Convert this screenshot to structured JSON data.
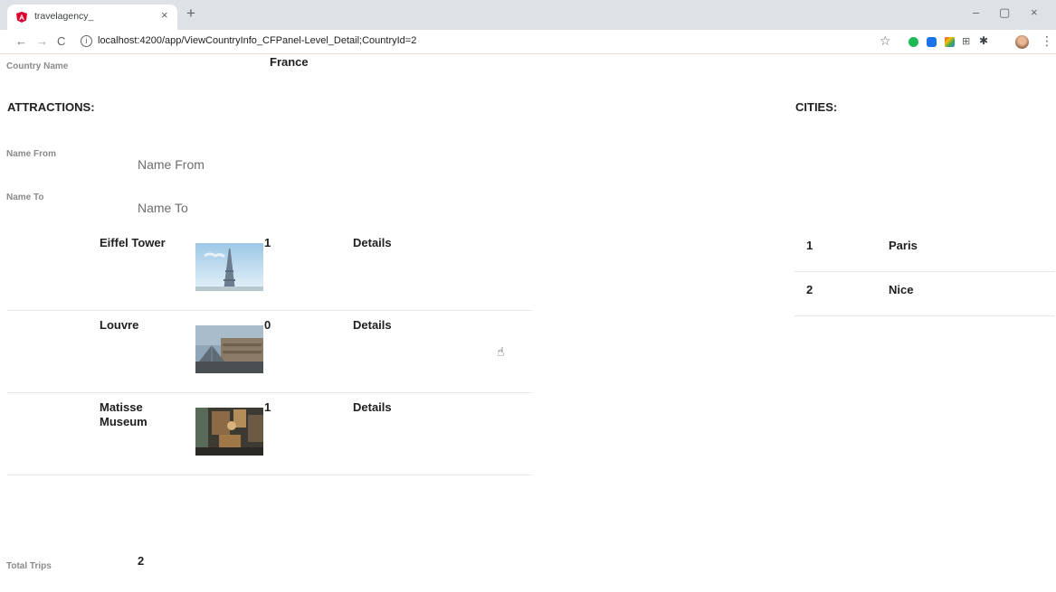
{
  "browser": {
    "tab_title": "travelagency_",
    "tab_close": "×",
    "new_tab": "+",
    "url": "localhost:4200/app/ViewCountryInfo_CFPanel-Level_Detail;CountryId=2",
    "window_controls": {
      "minimize": "–",
      "maximize": "▢",
      "close": "×"
    },
    "nav": {
      "back": "←",
      "forward": "→",
      "reload": "C"
    },
    "icons": [
      "angular-favicon-icon",
      "info-icon",
      "star-icon",
      "grammarly-icon",
      "extension-icon",
      "color-extension-icon",
      "grid-extension-icon",
      "puzzle-icon",
      "profile-avatar",
      "menu-dots-icon"
    ],
    "accent_color": "#dd0031"
  },
  "page": {
    "country_label": "Country Name",
    "country_value": "France",
    "attractions_title": "ATTRACTIONS:",
    "cities_title": "CITIES:",
    "name_from_label": "Name From",
    "name_from_placeholder": "Name From",
    "name_to_label": "Name To",
    "name_to_placeholder": "Name To",
    "attractions": [
      {
        "name": "Eiffel Tower",
        "count": "1",
        "details": "Details",
        "image": "eiffel-tower-photo"
      },
      {
        "name": "Louvre",
        "count": "0",
        "details": "Details",
        "image": "louvre-photo"
      },
      {
        "name": "Matisse Museum",
        "count": "1",
        "details": "Details",
        "image": "matisse-museum-photo"
      }
    ],
    "cities": [
      {
        "id": "1",
        "name": "Paris"
      },
      {
        "id": "2",
        "name": "Nice"
      }
    ],
    "total_trips_label": "Total Trips",
    "total_trips_value": "2"
  }
}
